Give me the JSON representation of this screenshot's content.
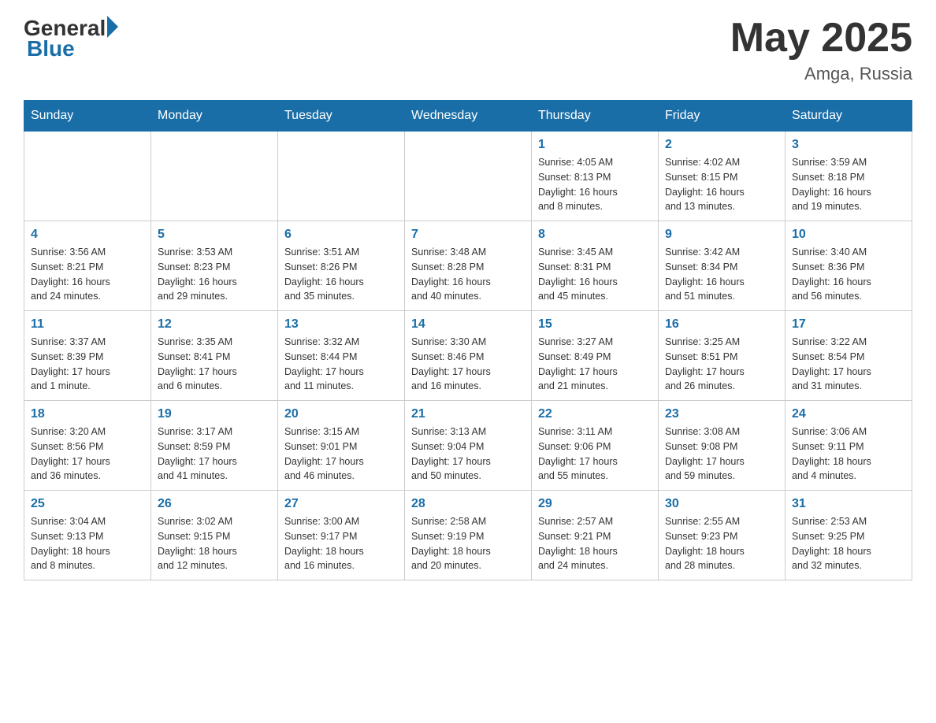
{
  "header": {
    "logo_general": "General",
    "logo_blue": "Blue",
    "month_year": "May 2025",
    "location": "Amga, Russia"
  },
  "days_of_week": [
    "Sunday",
    "Monday",
    "Tuesday",
    "Wednesday",
    "Thursday",
    "Friday",
    "Saturday"
  ],
  "weeks": [
    [
      {
        "day": "",
        "info": ""
      },
      {
        "day": "",
        "info": ""
      },
      {
        "day": "",
        "info": ""
      },
      {
        "day": "",
        "info": ""
      },
      {
        "day": "1",
        "info": "Sunrise: 4:05 AM\nSunset: 8:13 PM\nDaylight: 16 hours\nand 8 minutes."
      },
      {
        "day": "2",
        "info": "Sunrise: 4:02 AM\nSunset: 8:15 PM\nDaylight: 16 hours\nand 13 minutes."
      },
      {
        "day": "3",
        "info": "Sunrise: 3:59 AM\nSunset: 8:18 PM\nDaylight: 16 hours\nand 19 minutes."
      }
    ],
    [
      {
        "day": "4",
        "info": "Sunrise: 3:56 AM\nSunset: 8:21 PM\nDaylight: 16 hours\nand 24 minutes."
      },
      {
        "day": "5",
        "info": "Sunrise: 3:53 AM\nSunset: 8:23 PM\nDaylight: 16 hours\nand 29 minutes."
      },
      {
        "day": "6",
        "info": "Sunrise: 3:51 AM\nSunset: 8:26 PM\nDaylight: 16 hours\nand 35 minutes."
      },
      {
        "day": "7",
        "info": "Sunrise: 3:48 AM\nSunset: 8:28 PM\nDaylight: 16 hours\nand 40 minutes."
      },
      {
        "day": "8",
        "info": "Sunrise: 3:45 AM\nSunset: 8:31 PM\nDaylight: 16 hours\nand 45 minutes."
      },
      {
        "day": "9",
        "info": "Sunrise: 3:42 AM\nSunset: 8:34 PM\nDaylight: 16 hours\nand 51 minutes."
      },
      {
        "day": "10",
        "info": "Sunrise: 3:40 AM\nSunset: 8:36 PM\nDaylight: 16 hours\nand 56 minutes."
      }
    ],
    [
      {
        "day": "11",
        "info": "Sunrise: 3:37 AM\nSunset: 8:39 PM\nDaylight: 17 hours\nand 1 minute."
      },
      {
        "day": "12",
        "info": "Sunrise: 3:35 AM\nSunset: 8:41 PM\nDaylight: 17 hours\nand 6 minutes."
      },
      {
        "day": "13",
        "info": "Sunrise: 3:32 AM\nSunset: 8:44 PM\nDaylight: 17 hours\nand 11 minutes."
      },
      {
        "day": "14",
        "info": "Sunrise: 3:30 AM\nSunset: 8:46 PM\nDaylight: 17 hours\nand 16 minutes."
      },
      {
        "day": "15",
        "info": "Sunrise: 3:27 AM\nSunset: 8:49 PM\nDaylight: 17 hours\nand 21 minutes."
      },
      {
        "day": "16",
        "info": "Sunrise: 3:25 AM\nSunset: 8:51 PM\nDaylight: 17 hours\nand 26 minutes."
      },
      {
        "day": "17",
        "info": "Sunrise: 3:22 AM\nSunset: 8:54 PM\nDaylight: 17 hours\nand 31 minutes."
      }
    ],
    [
      {
        "day": "18",
        "info": "Sunrise: 3:20 AM\nSunset: 8:56 PM\nDaylight: 17 hours\nand 36 minutes."
      },
      {
        "day": "19",
        "info": "Sunrise: 3:17 AM\nSunset: 8:59 PM\nDaylight: 17 hours\nand 41 minutes."
      },
      {
        "day": "20",
        "info": "Sunrise: 3:15 AM\nSunset: 9:01 PM\nDaylight: 17 hours\nand 46 minutes."
      },
      {
        "day": "21",
        "info": "Sunrise: 3:13 AM\nSunset: 9:04 PM\nDaylight: 17 hours\nand 50 minutes."
      },
      {
        "day": "22",
        "info": "Sunrise: 3:11 AM\nSunset: 9:06 PM\nDaylight: 17 hours\nand 55 minutes."
      },
      {
        "day": "23",
        "info": "Sunrise: 3:08 AM\nSunset: 9:08 PM\nDaylight: 17 hours\nand 59 minutes."
      },
      {
        "day": "24",
        "info": "Sunrise: 3:06 AM\nSunset: 9:11 PM\nDaylight: 18 hours\nand 4 minutes."
      }
    ],
    [
      {
        "day": "25",
        "info": "Sunrise: 3:04 AM\nSunset: 9:13 PM\nDaylight: 18 hours\nand 8 minutes."
      },
      {
        "day": "26",
        "info": "Sunrise: 3:02 AM\nSunset: 9:15 PM\nDaylight: 18 hours\nand 12 minutes."
      },
      {
        "day": "27",
        "info": "Sunrise: 3:00 AM\nSunset: 9:17 PM\nDaylight: 18 hours\nand 16 minutes."
      },
      {
        "day": "28",
        "info": "Sunrise: 2:58 AM\nSunset: 9:19 PM\nDaylight: 18 hours\nand 20 minutes."
      },
      {
        "day": "29",
        "info": "Sunrise: 2:57 AM\nSunset: 9:21 PM\nDaylight: 18 hours\nand 24 minutes."
      },
      {
        "day": "30",
        "info": "Sunrise: 2:55 AM\nSunset: 9:23 PM\nDaylight: 18 hours\nand 28 minutes."
      },
      {
        "day": "31",
        "info": "Sunrise: 2:53 AM\nSunset: 9:25 PM\nDaylight: 18 hours\nand 32 minutes."
      }
    ]
  ]
}
